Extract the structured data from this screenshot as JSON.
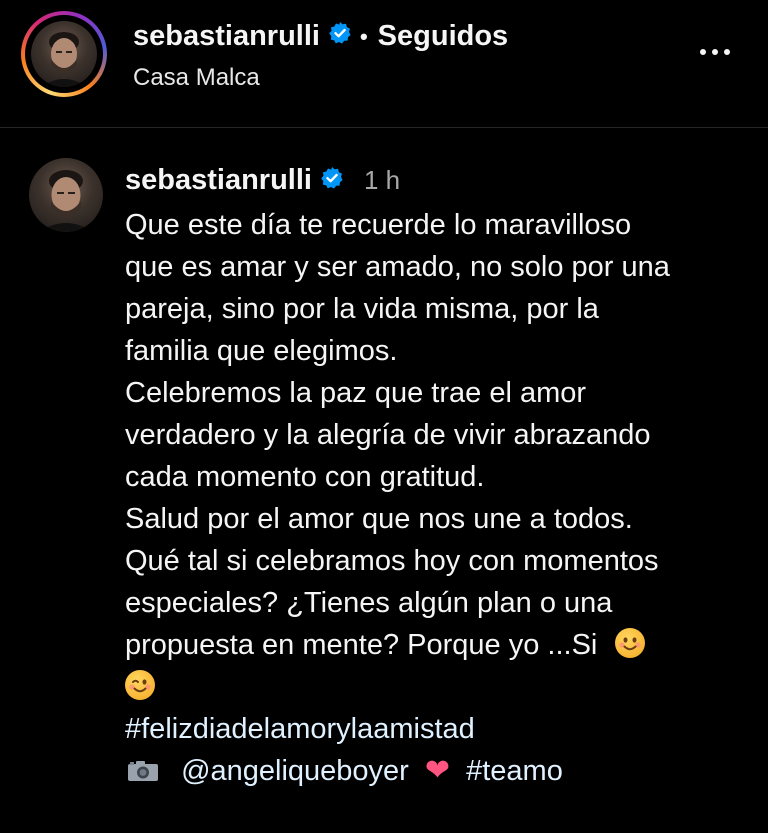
{
  "header": {
    "username": "sebastianrulli",
    "separator": "•",
    "follow_status": "Seguidos",
    "location": "Casa Malca"
  },
  "comment": {
    "username": "sebastianrulli",
    "time": "1 h",
    "lines": [
      "Que este día te recuerde lo maravilloso",
      "que es amar y ser amado, no solo por una",
      "pareja, sino por la vida misma, por la",
      "familia que elegimos.",
      "Celebremos la paz que trae el amor",
      "verdadero y la alegría de vivir abrazando",
      "cada momento con gratitud.",
      "Salud por el amor que nos une a todos.",
      "Qué tal si celebramos hoy con momentos",
      "especiales? ¿Tienes algún plan o una",
      "propuesta en mente? Porque yo ...Si"
    ],
    "hashtag": "#felizdiadelamorylaamistad",
    "mention": "@angeliqueboyer",
    "heart": "❤",
    "hashtag2": "#teamo"
  },
  "icons": {
    "verified": "verified-badge-icon",
    "more": "more-options-icon",
    "camera": "camera-icon",
    "smile": "smiling-face-icon",
    "wink": "winking-face-icon"
  },
  "colors": {
    "background": "#000000",
    "verified_blue": "#0095f6",
    "secondary_text": "#a8a8a8",
    "heart": "#ff3b6b"
  }
}
